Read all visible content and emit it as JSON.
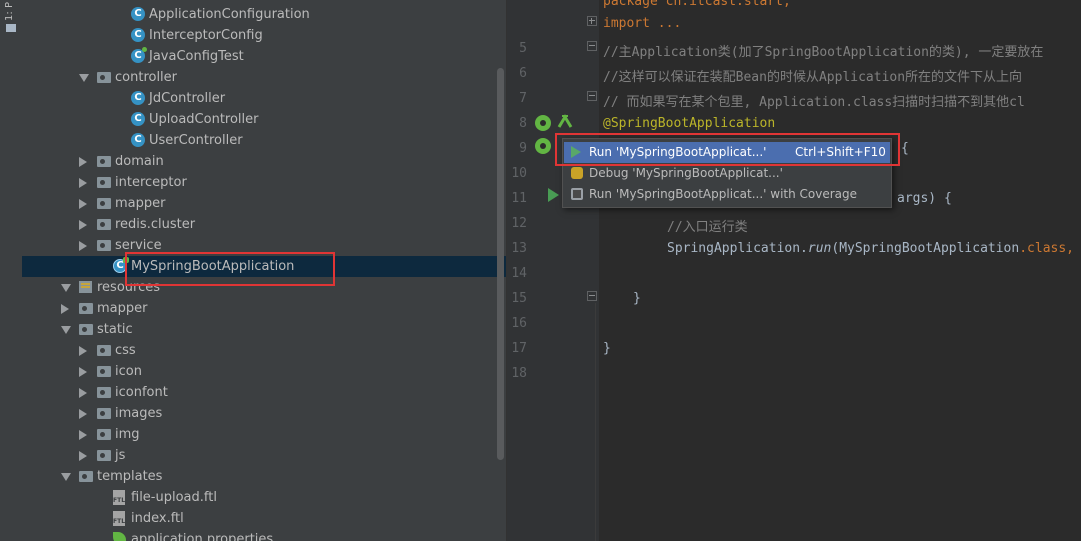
{
  "tool_strip": {
    "tab_label": "1: P"
  },
  "project_tree": [
    {
      "label": "ApplicationConfiguration",
      "kind": "class"
    },
    {
      "label": "InterceptorConfig",
      "kind": "class"
    },
    {
      "label": "JavaConfigTest",
      "kind": "class-test"
    },
    {
      "label": "controller",
      "kind": "package",
      "state": "expanded"
    },
    {
      "label": "JdController",
      "kind": "class"
    },
    {
      "label": "UploadController",
      "kind": "class"
    },
    {
      "label": "UserController",
      "kind": "class"
    },
    {
      "label": "domain",
      "kind": "package",
      "state": "collapsed"
    },
    {
      "label": "interceptor",
      "kind": "package",
      "state": "collapsed"
    },
    {
      "label": "mapper",
      "kind": "package",
      "state": "collapsed"
    },
    {
      "label": "redis.cluster",
      "kind": "package",
      "state": "collapsed"
    },
    {
      "label": "service",
      "kind": "package",
      "state": "collapsed"
    },
    {
      "label": "MySpringBootApplication",
      "kind": "class-boot",
      "selected": true
    },
    {
      "label": "resources",
      "kind": "resources",
      "state": "expanded"
    },
    {
      "label": "mapper",
      "kind": "folder",
      "state": "collapsed"
    },
    {
      "label": "static",
      "kind": "folder",
      "state": "expanded"
    },
    {
      "label": "css",
      "kind": "folder",
      "state": "collapsed"
    },
    {
      "label": "icon",
      "kind": "folder",
      "state": "collapsed"
    },
    {
      "label": "iconfont",
      "kind": "folder",
      "state": "collapsed"
    },
    {
      "label": "images",
      "kind": "folder",
      "state": "collapsed"
    },
    {
      "label": "img",
      "kind": "folder",
      "state": "collapsed"
    },
    {
      "label": "js",
      "kind": "folder",
      "state": "collapsed"
    },
    {
      "label": "templates",
      "kind": "folder",
      "state": "expanded"
    },
    {
      "label": "file-upload.ftl",
      "kind": "ftl"
    },
    {
      "label": "index.ftl",
      "kind": "ftl"
    },
    {
      "label": "application.properties",
      "kind": "properties"
    }
  ],
  "editor": {
    "lines": [
      {
        "num": "",
        "text": "package cn.itcast.start;"
      },
      {
        "num": "",
        "text": "import ..."
      },
      {
        "num": "5",
        "text": "//主Application类(加了SpringBootApplication的类), 一定要放在"
      },
      {
        "num": "6",
        "text": "//这样可以保证在装配Bean的时候从Application所在的文件下从上向"
      },
      {
        "num": "7",
        "text": "// 而如果写在某个包里, Application.class扫描时扫描不到其他cl"
      },
      {
        "num": "8",
        "text": "@SpringBootApplication"
      },
      {
        "num": "9",
        "text": "{"
      },
      {
        "num": "10",
        "text": ""
      },
      {
        "num": "11",
        "text": "args) {"
      },
      {
        "num": "12",
        "text": "//入口运行类"
      },
      {
        "num": "13",
        "code_call": "SpringApplication.",
        "code_method": "run",
        "code_arg": "(MySpringBootApplication",
        "code_kw": ".class,"
      },
      {
        "num": "14",
        "text": ""
      },
      {
        "num": "15",
        "text": "}"
      },
      {
        "num": "16",
        "text": ""
      },
      {
        "num": "17",
        "text": "}"
      },
      {
        "num": "18",
        "text": ""
      }
    ]
  },
  "context_menu": {
    "items": [
      {
        "label": "Run 'MySpringBootApplicat...'",
        "shortcut": "Ctrl+Shift+F10",
        "icon": "run-icon",
        "selected": true
      },
      {
        "label": "Debug 'MySpringBootApplicat...'",
        "shortcut": "",
        "icon": "debug-icon"
      },
      {
        "label": "Run 'MySpringBootApplicat...' with Coverage",
        "shortcut": "",
        "icon": "coverage-icon"
      }
    ]
  },
  "colors": {
    "panel_bg": "#3c3f41",
    "editor_bg": "#2b2b2b",
    "selection": "#0d293e",
    "menu_selection": "#4b6eaf",
    "highlight_box": "#e03535",
    "annotation": "#bbb529",
    "comment": "#808080",
    "keyword": "#cc7832"
  }
}
